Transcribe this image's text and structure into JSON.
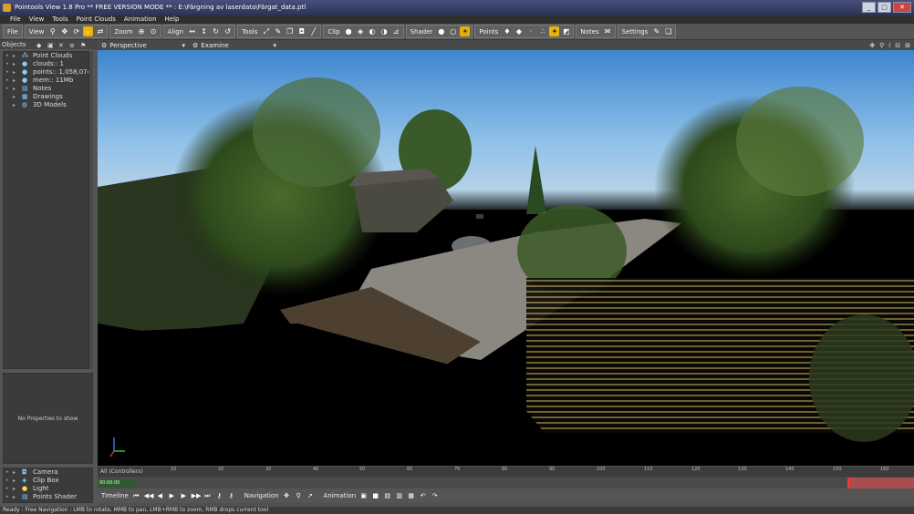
{
  "window": {
    "title": "Pointools View 1.8 Pro ** FREE VERSION MODE ** : E:\\Färgning av laserdata\\Färgat_data.ptl",
    "controls": [
      "_",
      "□",
      "✕"
    ]
  },
  "menu": [
    "File",
    "View",
    "Tools",
    "Point Clouds",
    "Animation",
    "Help"
  ],
  "toolbar": {
    "groups": [
      {
        "label": "File",
        "icons": []
      },
      {
        "label": "View",
        "icons": [
          "magnify-icon",
          "pan-icon",
          "orbit-icon",
          "hand-icon",
          "walk-icon"
        ]
      },
      {
        "label": "Zoom",
        "icons": [
          "zoom-in-icon",
          "zoom-fit-icon"
        ]
      },
      {
        "label": "Align",
        "icons": [
          "align-x-icon",
          "align-y-icon",
          "rotate-icon",
          "rotate-alt-icon"
        ]
      },
      {
        "label": "Tools",
        "icons": [
          "measure-icon",
          "pick-icon",
          "copy-icon",
          "camera-icon",
          "line-icon"
        ]
      },
      {
        "label": "Clip",
        "icons": [
          "clip-sphere-icon",
          "clip-box-icon",
          "clip-a-icon",
          "clip-b-icon",
          "clip-plane-icon"
        ]
      },
      {
        "label": "Shader",
        "icons": [
          "shade-dark-icon",
          "shade-light-icon",
          "shade-sun-icon"
        ]
      },
      {
        "label": "Points",
        "icons": [
          "points-a-icon",
          "points-b-icon",
          "points-c-icon",
          "points-d-icon",
          "points-e-icon",
          "points-rgb-icon"
        ]
      },
      {
        "label": "Notes",
        "icons": [
          "note-icon"
        ]
      },
      {
        "label": "Settings",
        "icons": [
          "settings-icon",
          "windows-icon"
        ]
      }
    ]
  },
  "objects": {
    "header": "Objects",
    "items": [
      {
        "label": "Point Clouds"
      },
      {
        "label": "clouds:: 1"
      },
      {
        "label": "points:: 1,058,074"
      },
      {
        "label": "mem:: 11Mb"
      },
      {
        "label": "Notes"
      },
      {
        "label": "Drawings"
      },
      {
        "label": "3D Models"
      }
    ],
    "properties_empty": "No Properties to show",
    "bottom_items": [
      {
        "label": "Camera"
      },
      {
        "label": "Clip Box"
      },
      {
        "label": "Light"
      },
      {
        "label": "Points Shader"
      }
    ]
  },
  "viewport": {
    "projection": "Perspective",
    "mode": "Examine"
  },
  "timeline": {
    "header": "All (Controllers)",
    "ticks": [
      "10",
      "20",
      "30",
      "40",
      "50",
      "60",
      "70",
      "80",
      "90",
      "100",
      "110",
      "120",
      "130",
      "140",
      "150",
      "160"
    ],
    "track_label": "00:00:00"
  },
  "controls": {
    "timeline_label": "Timeline",
    "navigation_label": "Navigation",
    "animation_label": "Animation"
  },
  "status": "Ready : Free Navigation : LMB to rotate, MMB to pan, LMB+RMB to zoom, RMB drops current tool",
  "colors": {
    "accent": "#e8b400",
    "sky_top": "#4a90d6",
    "ground": "#000000",
    "timeline_range": "#c95050"
  }
}
